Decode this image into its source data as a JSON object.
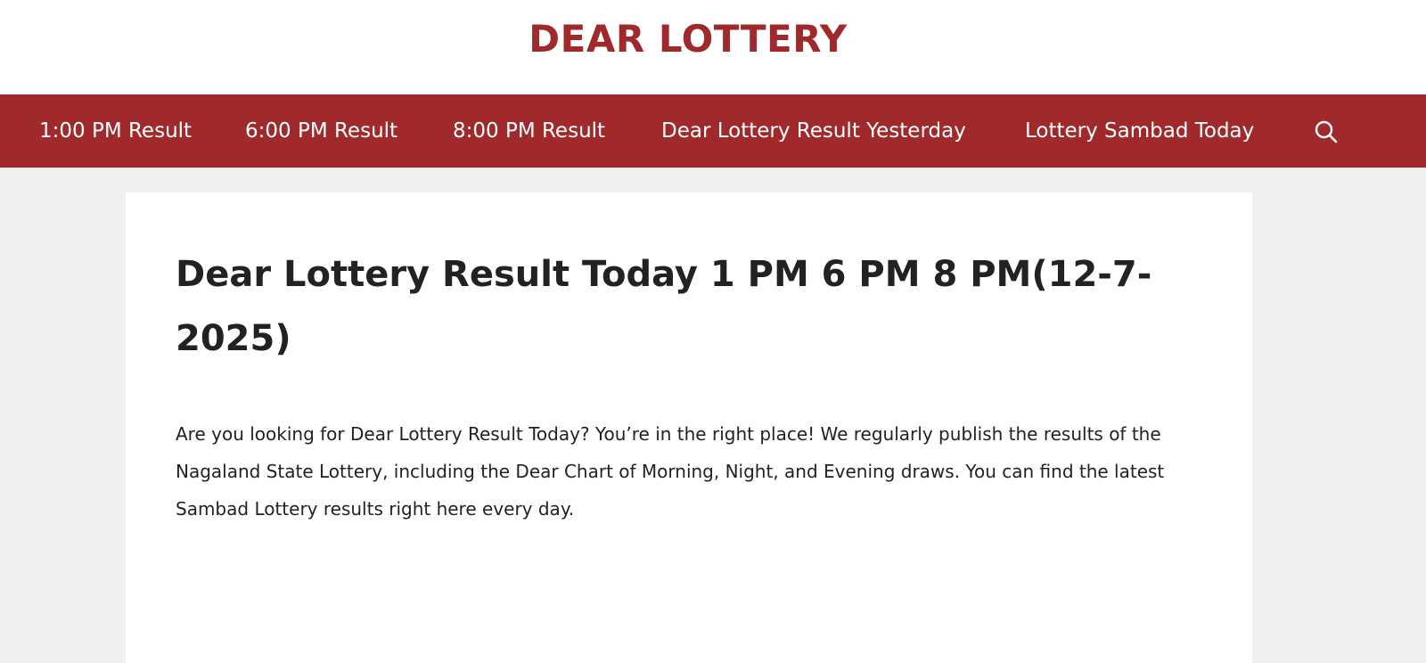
{
  "header": {
    "site_title": "DEAR LOTTERY"
  },
  "nav": {
    "items": [
      {
        "label": "1:00 PM Result"
      },
      {
        "label": "6:00 PM Result"
      },
      {
        "label": "8:00 PM Result"
      },
      {
        "label": "Dear Lottery Result Yesterday"
      },
      {
        "label": "Lottery Sambad Today"
      }
    ],
    "search_icon": "search-icon"
  },
  "article": {
    "title": "Dear Lottery Result Today 1 PM 6 PM 8 PM(12-7-2025)",
    "intro": "Are you looking for Dear Lottery Result Today? You’re in the right place! We regularly publish the results of the Nagaland State Lottery, including the Dear Chart of Morning, Night, and Evening draws. You can find the latest Sambad Lottery results right here every day."
  },
  "colors": {
    "brand": "#a0292c",
    "background": "#efefef",
    "text": "#222222"
  }
}
